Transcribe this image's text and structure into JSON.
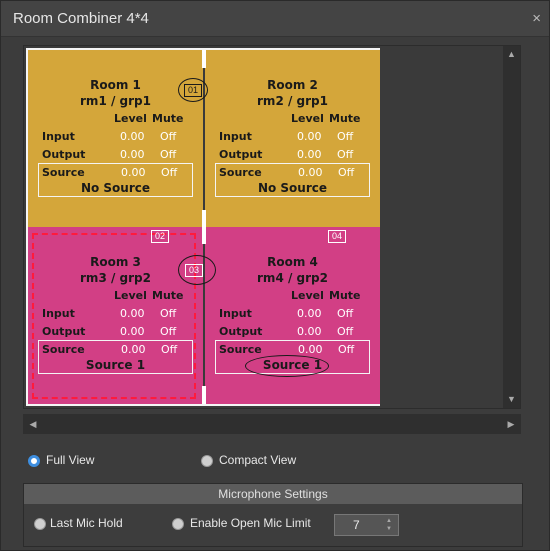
{
  "window": {
    "title": "Room Combiner 4*4",
    "close_glyph": "×"
  },
  "rooms": [
    {
      "name": "Room 1",
      "group_line": "rm1 / grp1",
      "color": "#d4a63a",
      "header_level": "Level",
      "header_mute": "Mute",
      "input": {
        "label": "Input",
        "level": "0.00",
        "mute": "Off"
      },
      "output": {
        "label": "Output",
        "level": "0.00",
        "mute": "Off"
      },
      "source": {
        "label": "Source",
        "level": "0.00",
        "mute": "Off",
        "name": "No Source"
      }
    },
    {
      "name": "Room 2",
      "group_line": "rm2 / grp1",
      "color": "#d4a63a",
      "header_level": "Level",
      "header_mute": "Mute",
      "input": {
        "label": "Input",
        "level": "0.00",
        "mute": "Off"
      },
      "output": {
        "label": "Output",
        "level": "0.00",
        "mute": "Off"
      },
      "source": {
        "label": "Source",
        "level": "0.00",
        "mute": "Off",
        "name": "No Source"
      }
    },
    {
      "name": "Room 3",
      "group_line": "rm3 / grp2",
      "color": "#d23f85",
      "header_level": "Level",
      "header_mute": "Mute",
      "input": {
        "label": "Input",
        "level": "0.00",
        "mute": "Off"
      },
      "output": {
        "label": "Output",
        "level": "0.00",
        "mute": "Off"
      },
      "source": {
        "label": "Source",
        "level": "0.00",
        "mute": "Off",
        "name": "Source 1"
      }
    },
    {
      "name": "Room 4",
      "group_line": "rm4 / grp2",
      "color": "#d23f85",
      "header_level": "Level",
      "header_mute": "Mute",
      "input": {
        "label": "Input",
        "level": "0.00",
        "mute": "Off"
      },
      "output": {
        "label": "Output",
        "level": "0.00",
        "mute": "Off"
      },
      "source": {
        "label": "Source",
        "level": "0.00",
        "mute": "Off",
        "name": "Source 1"
      }
    }
  ],
  "badges": {
    "b01": "01",
    "b02": "02",
    "b03": "03",
    "b04": "04"
  },
  "view_options": {
    "full": "Full View",
    "compact": "Compact View",
    "selected": "full"
  },
  "mic": {
    "title": "Microphone Settings",
    "last_mic_hold": "Last Mic Hold",
    "open_mic_limit": "Enable Open Mic Limit",
    "limit_value": "7"
  }
}
